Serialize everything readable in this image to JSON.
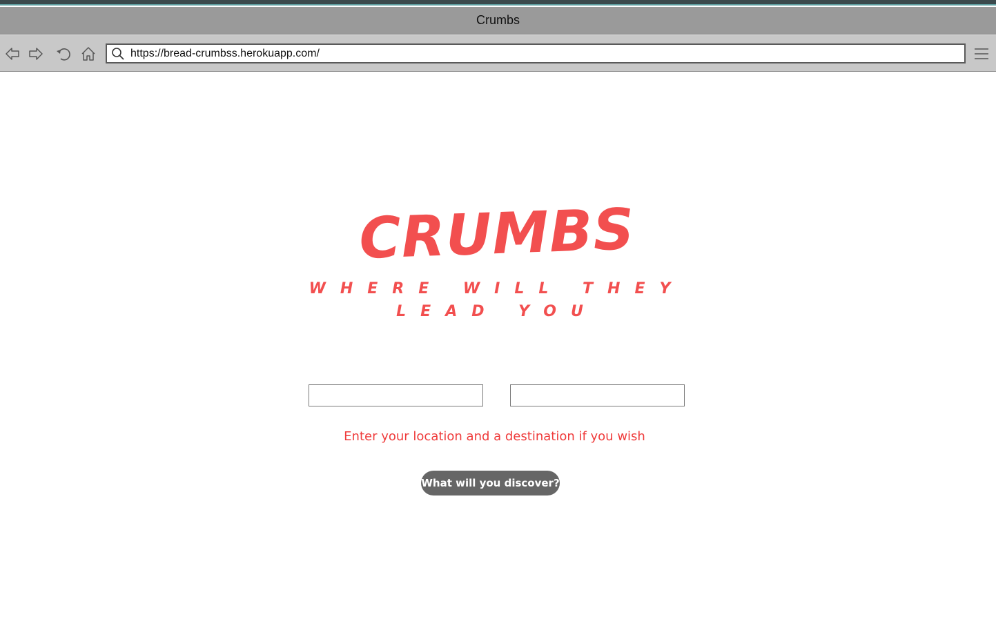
{
  "browser": {
    "window_title": "Crumbs",
    "url": "https://bread-crumbss.herokuapp.com/",
    "icons": {
      "back": "back-arrow-icon",
      "forward": "forward-arrow-icon",
      "reload": "reload-icon",
      "home": "home-icon",
      "search": "search-icon",
      "menu": "hamburger-menu-icon"
    }
  },
  "page": {
    "logo_title": "CRUMBS",
    "logo_tagline": "WHERE WILL THEY LEAD YOU",
    "location_input": {
      "value": "",
      "placeholder": ""
    },
    "destination_input": {
      "value": "",
      "placeholder": ""
    },
    "hint": "Enter your location and a destination if you wish",
    "submit_label": "What will you discover?"
  },
  "colors": {
    "accent_red": "#f24f4f",
    "hint_red": "#ef3b3b",
    "button_gray": "#666666",
    "titlebar_gray": "#9a9a9a",
    "toolbar_gray": "#c8c8c8"
  }
}
